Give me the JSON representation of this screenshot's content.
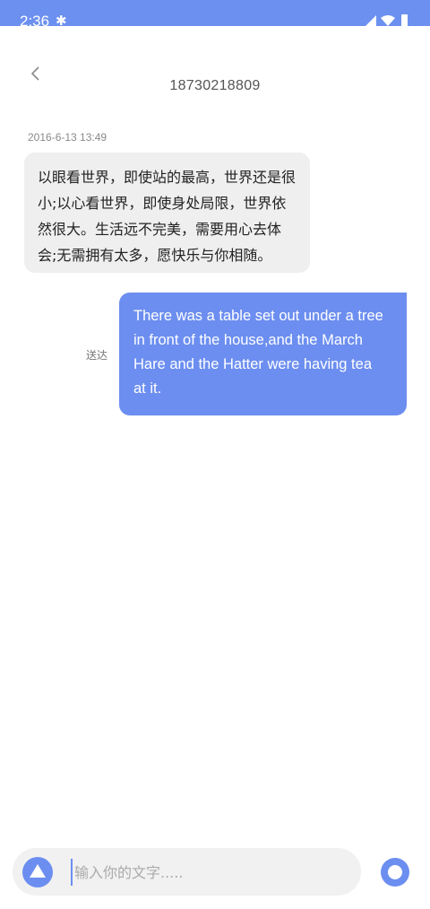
{
  "status_bar": {
    "time": "2:36",
    "bluetooth_icon": "bluetooth-icon",
    "signal_icon": "signal-icon",
    "wifi_icon": "wifi-icon",
    "battery_icon": "battery-icon",
    "color": "#6c90ef"
  },
  "header": {
    "back_icon": "chevron-left-icon",
    "title": "18730218809"
  },
  "messages": [
    {
      "direction": "incoming",
      "timestamp": "2016-6-13 13:49",
      "lines": [
        "以眼看世界，即使站的最高，世界还是很",
        "小;以心看世界，即使身处局限，世界依",
        "然很大。生活远不完美，需要用心去体",
        "会;无需拥有太多，愿快乐与你相随。"
      ],
      "bubble_color": "#efefef"
    },
    {
      "direction": "outgoing",
      "status": "送达",
      "lines": [
        "There was a table set out under a tree",
        "in front of the house,and the March",
        "Hare and the Hatter were having tea",
        "at it."
      ],
      "bubble_color": "#6c8ef0"
    }
  ],
  "composer": {
    "left_icon": "triangle-icon",
    "placeholder": "输入你的文字.....",
    "value": "",
    "right_icon": "record-icon",
    "accent": "#6c8ef0"
  }
}
